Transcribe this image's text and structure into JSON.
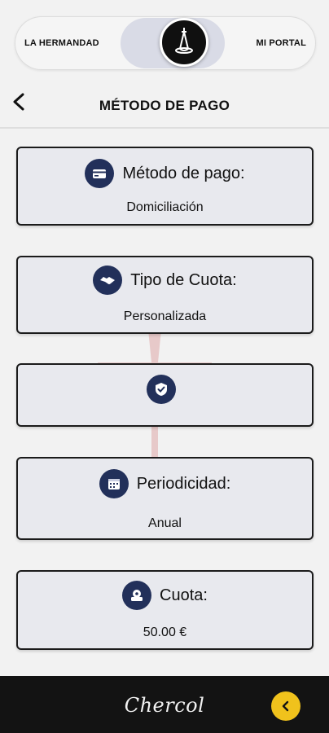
{
  "toggle": {
    "left_label": "LA HERMANDAD",
    "right_label": "MI PORTAL"
  },
  "header": {
    "title": "MÉTODO DE PAGO"
  },
  "cards": [
    {
      "label": "Método de pago:",
      "value": "Domiciliación",
      "icon": "credit-card-icon"
    },
    {
      "label": "Tipo de Cuota:",
      "value": "Personalizada",
      "icon": "handshake-icon"
    },
    {
      "label": "",
      "value": "",
      "icon": "shield-check-icon"
    },
    {
      "label": "Periodicidad:",
      "value": "Anual",
      "icon": "calendar-icon"
    },
    {
      "label": "Cuota:",
      "value": "50.00 €",
      "icon": "money-icon"
    }
  ],
  "footer": {
    "logo_text": "Chercol",
    "back_icon": "chevron-left-icon"
  },
  "colors": {
    "icon_bg": "#22305a",
    "card_bg": "#e8e9ee",
    "footer_bg": "#131313",
    "accent_yellow": "#f0c21c"
  }
}
